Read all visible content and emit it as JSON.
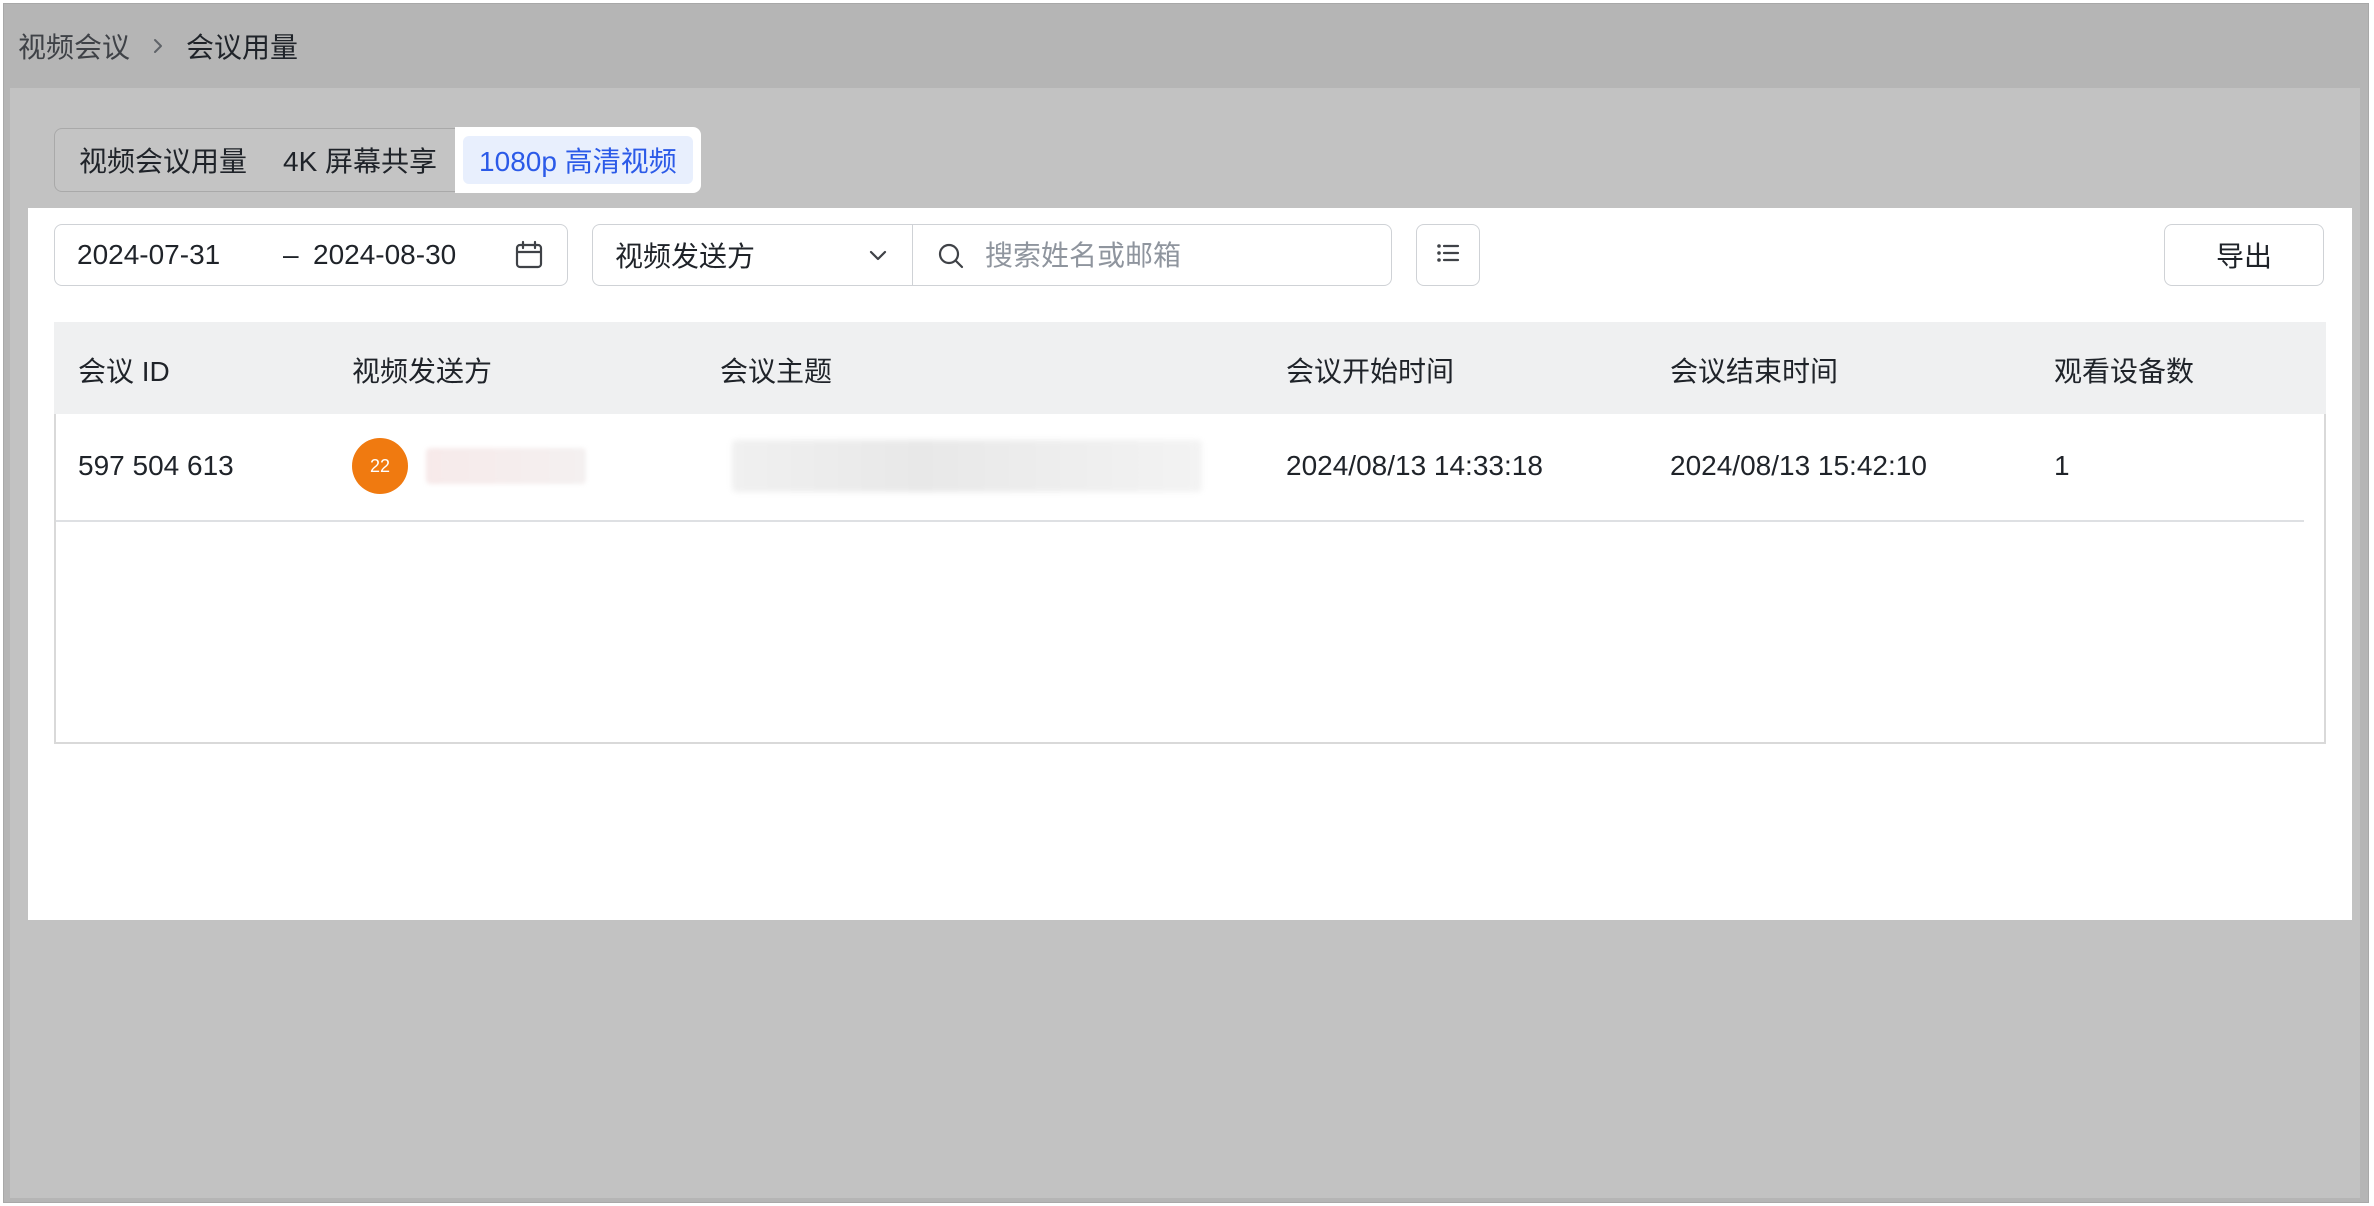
{
  "breadcrumb": {
    "parent": "视频会议",
    "current": "会议用量"
  },
  "tabs": [
    {
      "label": "视频会议用量"
    },
    {
      "label": "4K 屏幕共享"
    },
    {
      "label": "1080p 高清视频"
    }
  ],
  "filters": {
    "date_start": "2024-07-31",
    "date_separator": "–",
    "date_end": "2024-08-30",
    "sender_select": "视频发送方",
    "search_placeholder": "搜索姓名或邮箱",
    "export_label": "导出"
  },
  "table": {
    "headers": [
      "会议 ID",
      "视频发送方",
      "会议主题",
      "会议开始时间",
      "会议结束时间",
      "观看设备数"
    ],
    "rows": [
      {
        "meeting_id": "597 504 613",
        "avatar_text": "22",
        "start_time": "2024/08/13 14:33:18",
        "end_time": "2024/08/13 15:42:10",
        "devices": "1"
      }
    ]
  },
  "colors": {
    "accent": "#2b5ae8",
    "avatar": "#f07a10"
  }
}
